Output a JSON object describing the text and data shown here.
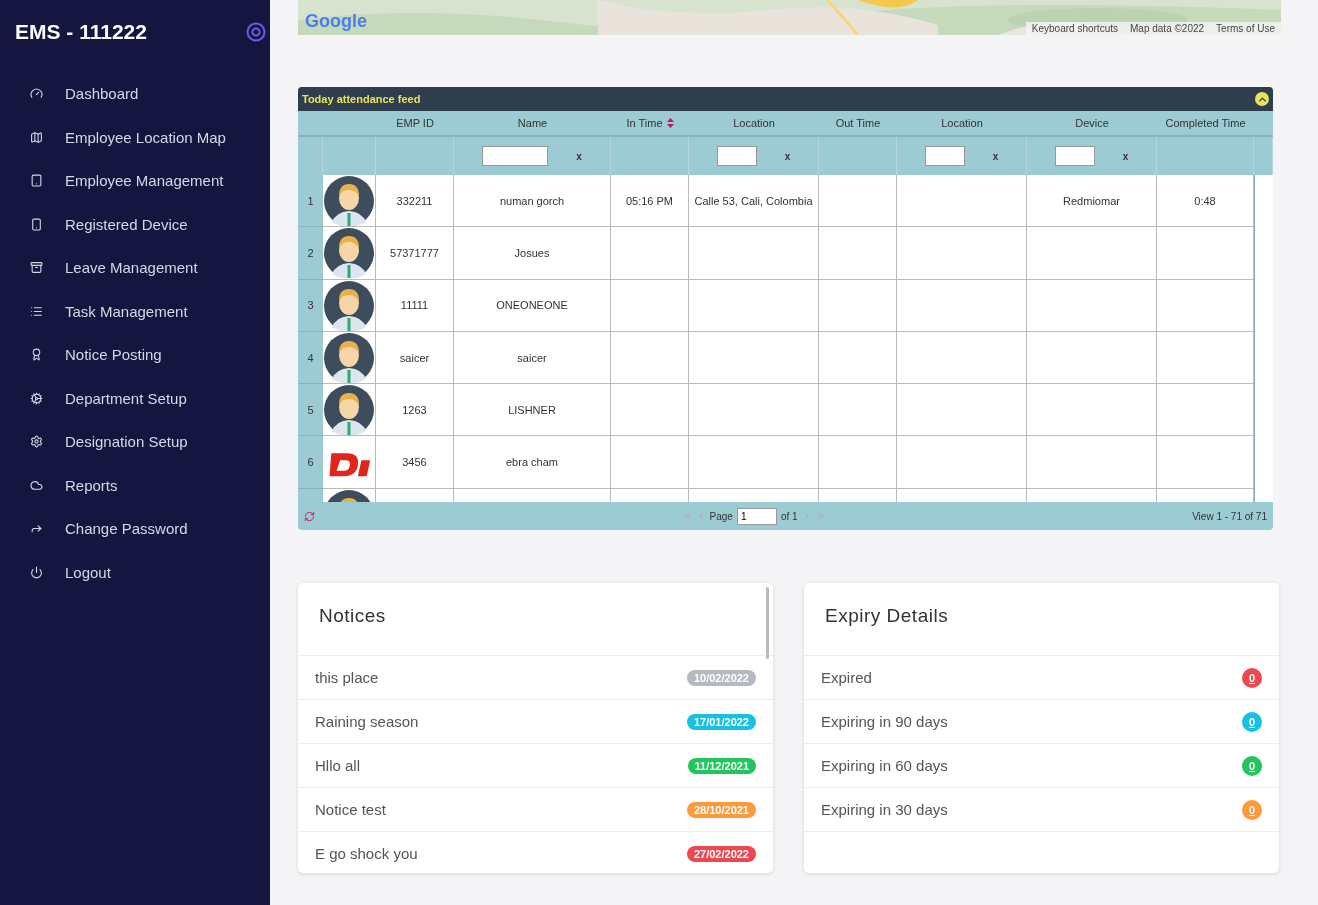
{
  "sidebar": {
    "brand": "EMS - 111222",
    "items": [
      {
        "label": "Dashboard"
      },
      {
        "label": "Employee Location Map"
      },
      {
        "label": "Employee Management"
      },
      {
        "label": "Registered Device"
      },
      {
        "label": "Leave Management"
      },
      {
        "label": "Task Management"
      },
      {
        "label": "Notice Posting"
      },
      {
        "label": "Department Setup"
      },
      {
        "label": "Designation Setup"
      },
      {
        "label": "Reports"
      },
      {
        "label": "Change Password"
      },
      {
        "label": "Logout"
      }
    ]
  },
  "map": {
    "kind": "picture",
    "attribution": [
      "Keyboard shortcuts",
      "Map data ©2022",
      "Terms of Use"
    ],
    "logo": "Google"
  },
  "grid": {
    "title": "Today attendance feed",
    "columns": [
      {
        "label": "EMP ID"
      },
      {
        "label": "Name",
        "filter": {
          "clear": "x"
        }
      },
      {
        "label": "In Time",
        "sortable": true
      },
      {
        "label": "Location",
        "filter": {
          "clear": "x"
        }
      },
      {
        "label": "Out Time"
      },
      {
        "label": "Location",
        "filter": {
          "clear": "x"
        }
      },
      {
        "label": "Device",
        "filter": {
          "clear": "x"
        }
      },
      {
        "label": "Completed Time"
      }
    ],
    "rows": [
      {
        "number": "1",
        "photo": {
          "kind": "avatar"
        },
        "cells": [
          "332211",
          "numan gorch",
          "05:16 PM",
          "Calle 53, Cali, Colombia",
          "",
          "",
          "Redmiomar",
          "0:48"
        ]
      },
      {
        "number": "2",
        "photo": {
          "kind": "avatar"
        },
        "cells": [
          "57371777",
          "Josues",
          "",
          "",
          "",
          "",
          "",
          ""
        ]
      },
      {
        "number": "3",
        "photo": {
          "kind": "avatar"
        },
        "cells": [
          "11111",
          "ONEONEONE",
          "",
          "",
          "",
          "",
          "",
          ""
        ]
      },
      {
        "number": "4",
        "photo": {
          "kind": "avatar"
        },
        "cells": [
          "saicer",
          "saicer",
          "",
          "",
          "",
          "",
          "",
          ""
        ]
      },
      {
        "number": "5",
        "photo": {
          "kind": "avatar"
        },
        "cells": [
          "1263",
          "LISHNER",
          "",
          "",
          "",
          "",
          "",
          ""
        ]
      },
      {
        "number": "6",
        "photo": {
          "kind": "logo"
        },
        "cells": [
          "3456",
          "ebra cham",
          "",
          "",
          "",
          "",
          "",
          ""
        ]
      },
      {
        "photo": {
          "kind": "avatar"
        },
        "cells": [
          "",
          "",
          "",
          "",
          "",
          "",
          "",
          ""
        ]
      }
    ],
    "pager": {
      "page_label": "Page",
      "page": "1",
      "of": "of 1",
      "summary": "View 1 - 71 of 71"
    }
  },
  "notices": {
    "title": "Notices",
    "items": [
      {
        "text": "this place",
        "date": "10/02/2022",
        "color": "#b4b9c4"
      },
      {
        "text": "Raining season",
        "date": "17/01/2022",
        "color": "#17c1e3"
      },
      {
        "text": "Hllo all",
        "date": "11/12/2021",
        "color": "#22c55e"
      },
      {
        "text": "Notice test",
        "date": "28/10/2021",
        "color": "#fb9a3c"
      },
      {
        "text": "E go shock you",
        "date": "27/02/2022",
        "color": "#ec4850"
      }
    ]
  },
  "expiry": {
    "title": "Expiry Details",
    "items": [
      {
        "label": "Expired",
        "count": "0",
        "color": "#ec4850"
      },
      {
        "label": "Expiring in 90 days",
        "count": "0",
        "color": "#17c1e3"
      },
      {
        "label": "Expiring in 60 days",
        "count": "0",
        "color": "#22c55e"
      },
      {
        "label": "Expiring in 30 days",
        "count": "0",
        "color": "#fb9a3c"
      }
    ]
  }
}
